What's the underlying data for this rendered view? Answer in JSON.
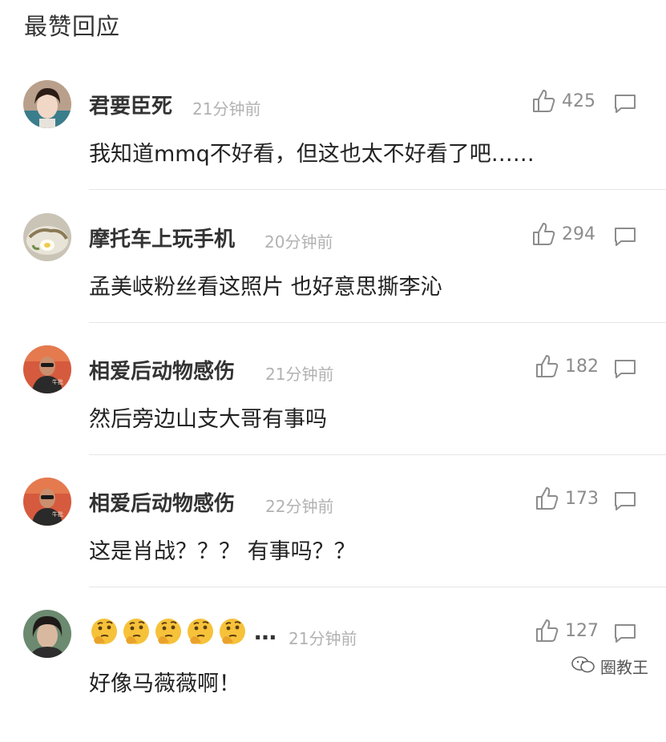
{
  "section": {
    "title": "最赞回应"
  },
  "comments": [
    {
      "user": "君要臣死",
      "time": "21分钟前",
      "text": "我知道mmq不好看，但这也太不好看了吧……",
      "likes": "425"
    },
    {
      "user": "摩托车上玩手机",
      "time": "20分钟前",
      "text": "孟美岐粉丝看这照片 也好意思撕李沁",
      "likes": "294"
    },
    {
      "user": "相爱后动物感伤",
      "time": "21分钟前",
      "text": "然后旁边山支大哥有事吗",
      "likes": "182"
    },
    {
      "user": "相爱后动物感伤",
      "time": "22分钟前",
      "text": "这是肖战？？？ 有事吗？？",
      "likes": "173"
    },
    {
      "user_emoji": [
        "🤔",
        "🤔",
        "🤔",
        "🤔",
        "🤔"
      ],
      "user_ellipsis": "…",
      "time": "21分钟前",
      "text": "好像马薇薇啊！",
      "likes": "127"
    }
  ],
  "watermark": {
    "label": "圈教王"
  },
  "icons": {
    "like": "thumbs-up-icon",
    "reply": "speech-bubble-icon",
    "watermark": "wechat-icon"
  },
  "colors": {
    "meta_gray": "#b2b2b2",
    "count_gray": "#8c8c8c",
    "divider": "#e6e6e6"
  }
}
